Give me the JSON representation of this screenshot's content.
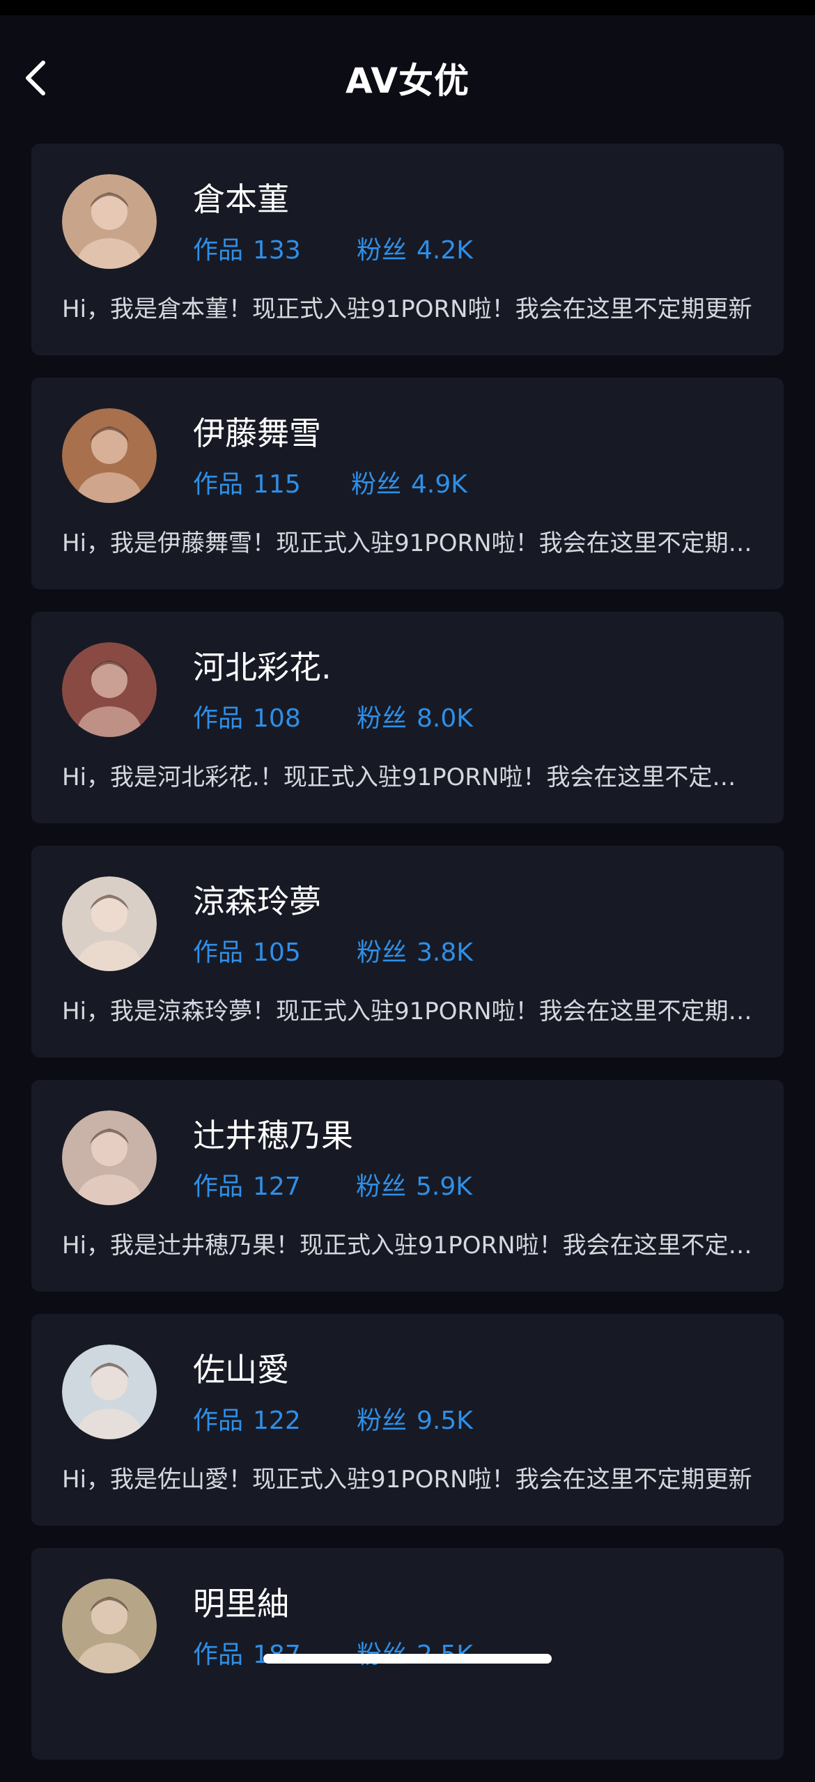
{
  "header": {
    "title": "AV女优"
  },
  "labels": {
    "works": "作品",
    "fans": "粉丝"
  },
  "performers": [
    {
      "name": "倉本菫",
      "works": "133",
      "fans": "4.2K",
      "bio": "Hi，我是倉本菫！现正式入驻91PORN啦！我会在这里不定期更新",
      "avatar_color": "#c8a58a"
    },
    {
      "name": "伊藤舞雪",
      "works": "115",
      "fans": "4.9K",
      "bio": "Hi，我是伊藤舞雪！现正式入驻91PORN啦！我会在这里不定期更新",
      "avatar_color": "#a8704d"
    },
    {
      "name": "河北彩花.",
      "works": "108",
      "fans": "8.0K",
      "bio": "Hi，我是河北彩花.！现正式入驻91PORN啦！我会在这里不定期更新",
      "avatar_color": "#8a4a44"
    },
    {
      "name": "涼森玲夢",
      "works": "105",
      "fans": "3.8K",
      "bio": "Hi，我是涼森玲夢！现正式入驻91PORN啦！我会在这里不定期更新",
      "avatar_color": "#d9cfc7"
    },
    {
      "name": "辻井穂乃果",
      "works": "127",
      "fans": "5.9K",
      "bio": "Hi，我是辻井穂乃果！现正式入驻91PORN啦！我会在这里不定期更新",
      "avatar_color": "#c9b2a8"
    },
    {
      "name": "佐山愛",
      "works": "122",
      "fans": "9.5K",
      "bio": "Hi，我是佐山愛！现正式入驻91PORN啦！我会在这里不定期更新",
      "avatar_color": "#cfd8de"
    },
    {
      "name": "明里紬",
      "works": "187",
      "fans": "2.5K",
      "bio": "",
      "avatar_color": "#b7a588"
    }
  ]
}
